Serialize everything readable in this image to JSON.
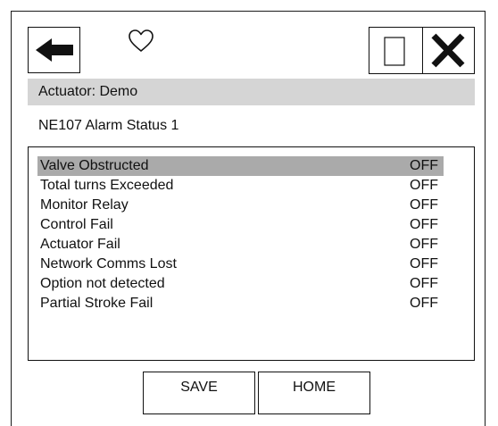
{
  "header": {
    "actuator_label": "Actuator: Demo",
    "title": "NE107 Alarm Status 1",
    "icons": {
      "back": "back-arrow-icon",
      "favorite": "heart-outline-icon",
      "stop": "square-icon",
      "close": "close-icon"
    }
  },
  "alarms": [
    {
      "label": "Valve Obstructed",
      "status": "OFF",
      "selected": true
    },
    {
      "label": "Total turns Exceeded",
      "status": "OFF"
    },
    {
      "label": "Monitor Relay",
      "status": "OFF"
    },
    {
      "label": "Control Fail",
      "status": "OFF"
    },
    {
      "label": "Actuator Fail",
      "status": "OFF"
    },
    {
      "label": "Network Comms Lost",
      "status": "OFF"
    },
    {
      "label": "Option not detected",
      "status": "OFF"
    },
    {
      "label": "Partial Stroke Fail",
      "status": "OFF"
    }
  ],
  "buttons": {
    "save": "SAVE",
    "home": "HOME"
  },
  "colors": {
    "header_bar": "#d5d5d5",
    "selected_row": "#aaaaaa",
    "border": "#111111"
  }
}
